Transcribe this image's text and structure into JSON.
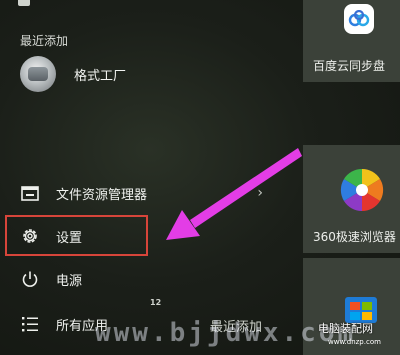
{
  "app_list": {
    "section_title": "最近添加",
    "recent_app": {
      "label": "格式工厂",
      "icon": "format-factory-icon"
    }
  },
  "menu": {
    "file_explorer": {
      "label": "文件资源管理器",
      "icon": "file-explorer-icon",
      "chevron": "›"
    },
    "settings": {
      "label": "设置",
      "icon": "gear-icon"
    },
    "power": {
      "label": "电源",
      "icon": "power-icon"
    },
    "all_apps": {
      "label": "所有应用",
      "icon": "list-icon"
    }
  },
  "bottom": {
    "recent_label": "最近添加",
    "mark": "12"
  },
  "tiles": {
    "baidu": {
      "label": "百度云同步盘",
      "icon": "baidu-cloud-icon"
    },
    "browser360": {
      "label": "360极速浏览器",
      "icon": "360-browser-icon"
    },
    "store": {
      "icon": "store-icon"
    }
  },
  "watermark": {
    "text": "www.bjjdwx.com",
    "logo": "电脑装配网",
    "sub": "www.dnzp.com"
  },
  "colors": {
    "highlight_border": "#d7453a",
    "arrow": "#e33de6",
    "tile_bg": "#3b4139"
  }
}
